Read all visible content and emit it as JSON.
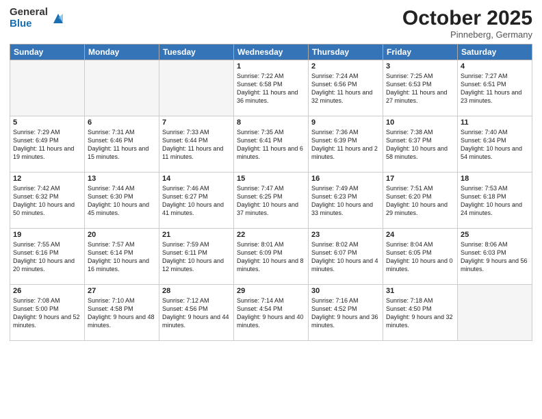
{
  "logo": {
    "general": "General",
    "blue": "Blue"
  },
  "title": "October 2025",
  "subtitle": "Pinneberg, Germany",
  "days": [
    "Sunday",
    "Monday",
    "Tuesday",
    "Wednesday",
    "Thursday",
    "Friday",
    "Saturday"
  ],
  "weeks": [
    [
      {
        "num": "",
        "empty": true
      },
      {
        "num": "",
        "empty": true
      },
      {
        "num": "",
        "empty": true
      },
      {
        "num": "1",
        "text": "Sunrise: 7:22 AM\nSunset: 6:58 PM\nDaylight: 11 hours\nand 36 minutes."
      },
      {
        "num": "2",
        "text": "Sunrise: 7:24 AM\nSunset: 6:56 PM\nDaylight: 11 hours\nand 32 minutes."
      },
      {
        "num": "3",
        "text": "Sunrise: 7:25 AM\nSunset: 6:53 PM\nDaylight: 11 hours\nand 27 minutes."
      },
      {
        "num": "4",
        "text": "Sunrise: 7:27 AM\nSunset: 6:51 PM\nDaylight: 11 hours\nand 23 minutes."
      }
    ],
    [
      {
        "num": "5",
        "text": "Sunrise: 7:29 AM\nSunset: 6:49 PM\nDaylight: 11 hours\nand 19 minutes."
      },
      {
        "num": "6",
        "text": "Sunrise: 7:31 AM\nSunset: 6:46 PM\nDaylight: 11 hours\nand 15 minutes."
      },
      {
        "num": "7",
        "text": "Sunrise: 7:33 AM\nSunset: 6:44 PM\nDaylight: 11 hours\nand 11 minutes."
      },
      {
        "num": "8",
        "text": "Sunrise: 7:35 AM\nSunset: 6:41 PM\nDaylight: 11 hours\nand 6 minutes."
      },
      {
        "num": "9",
        "text": "Sunrise: 7:36 AM\nSunset: 6:39 PM\nDaylight: 11 hours\nand 2 minutes."
      },
      {
        "num": "10",
        "text": "Sunrise: 7:38 AM\nSunset: 6:37 PM\nDaylight: 10 hours\nand 58 minutes."
      },
      {
        "num": "11",
        "text": "Sunrise: 7:40 AM\nSunset: 6:34 PM\nDaylight: 10 hours\nand 54 minutes."
      }
    ],
    [
      {
        "num": "12",
        "text": "Sunrise: 7:42 AM\nSunset: 6:32 PM\nDaylight: 10 hours\nand 50 minutes."
      },
      {
        "num": "13",
        "text": "Sunrise: 7:44 AM\nSunset: 6:30 PM\nDaylight: 10 hours\nand 45 minutes."
      },
      {
        "num": "14",
        "text": "Sunrise: 7:46 AM\nSunset: 6:27 PM\nDaylight: 10 hours\nand 41 minutes."
      },
      {
        "num": "15",
        "text": "Sunrise: 7:47 AM\nSunset: 6:25 PM\nDaylight: 10 hours\nand 37 minutes."
      },
      {
        "num": "16",
        "text": "Sunrise: 7:49 AM\nSunset: 6:23 PM\nDaylight: 10 hours\nand 33 minutes."
      },
      {
        "num": "17",
        "text": "Sunrise: 7:51 AM\nSunset: 6:20 PM\nDaylight: 10 hours\nand 29 minutes."
      },
      {
        "num": "18",
        "text": "Sunrise: 7:53 AM\nSunset: 6:18 PM\nDaylight: 10 hours\nand 24 minutes."
      }
    ],
    [
      {
        "num": "19",
        "text": "Sunrise: 7:55 AM\nSunset: 6:16 PM\nDaylight: 10 hours\nand 20 minutes."
      },
      {
        "num": "20",
        "text": "Sunrise: 7:57 AM\nSunset: 6:14 PM\nDaylight: 10 hours\nand 16 minutes."
      },
      {
        "num": "21",
        "text": "Sunrise: 7:59 AM\nSunset: 6:11 PM\nDaylight: 10 hours\nand 12 minutes."
      },
      {
        "num": "22",
        "text": "Sunrise: 8:01 AM\nSunset: 6:09 PM\nDaylight: 10 hours\nand 8 minutes."
      },
      {
        "num": "23",
        "text": "Sunrise: 8:02 AM\nSunset: 6:07 PM\nDaylight: 10 hours\nand 4 minutes."
      },
      {
        "num": "24",
        "text": "Sunrise: 8:04 AM\nSunset: 6:05 PM\nDaylight: 10 hours\nand 0 minutes."
      },
      {
        "num": "25",
        "text": "Sunrise: 8:06 AM\nSunset: 6:03 PM\nDaylight: 9 hours\nand 56 minutes."
      }
    ],
    [
      {
        "num": "26",
        "text": "Sunrise: 7:08 AM\nSunset: 5:00 PM\nDaylight: 9 hours\nand 52 minutes."
      },
      {
        "num": "27",
        "text": "Sunrise: 7:10 AM\nSunset: 4:58 PM\nDaylight: 9 hours\nand 48 minutes."
      },
      {
        "num": "28",
        "text": "Sunrise: 7:12 AM\nSunset: 4:56 PM\nDaylight: 9 hours\nand 44 minutes."
      },
      {
        "num": "29",
        "text": "Sunrise: 7:14 AM\nSunset: 4:54 PM\nDaylight: 9 hours\nand 40 minutes."
      },
      {
        "num": "30",
        "text": "Sunrise: 7:16 AM\nSunset: 4:52 PM\nDaylight: 9 hours\nand 36 minutes."
      },
      {
        "num": "31",
        "text": "Sunrise: 7:18 AM\nSunset: 4:50 PM\nDaylight: 9 hours\nand 32 minutes."
      },
      {
        "num": "",
        "empty": true
      }
    ]
  ]
}
